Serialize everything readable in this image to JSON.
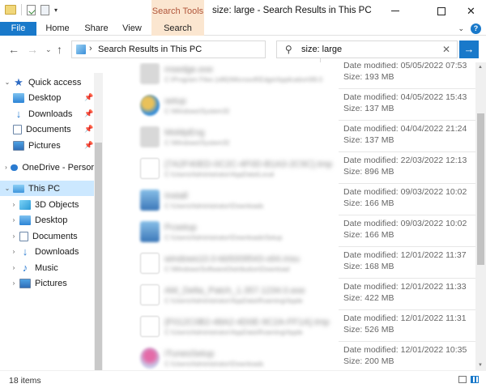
{
  "window": {
    "title": "size: large - Search Results in This PC",
    "context_tab_group": "Search Tools"
  },
  "ribbon": {
    "tabs": [
      "File",
      "Home",
      "Share",
      "View",
      "Search"
    ]
  },
  "address": {
    "path": "Search Results in This PC"
  },
  "search": {
    "query": "size: large"
  },
  "nav": {
    "items": [
      {
        "label": "Quick access"
      },
      {
        "label": "Desktop"
      },
      {
        "label": "Downloads"
      },
      {
        "label": "Documents"
      },
      {
        "label": "Pictures"
      },
      {
        "label": "OneDrive - Persor"
      },
      {
        "label": "This PC"
      },
      {
        "label": "3D Objects"
      },
      {
        "label": "Desktop"
      },
      {
        "label": "Documents"
      },
      {
        "label": "Downloads"
      },
      {
        "label": "Music"
      },
      {
        "label": "Pictures"
      }
    ]
  },
  "results": [
    {
      "name": "msedge.exe",
      "path": "C:\\Program Files (x86)\\Microsoft\\Edge\\Application\\99.0",
      "date_modified": "Date modified: 05/05/2022 07:53",
      "size": "Size: 193 MB",
      "icon": "gray-app-icon"
    },
    {
      "name": "setup",
      "path": "C:\\Windows\\System32",
      "date_modified": "Date modified: 04/05/2022 15:43",
      "size": "Size: 137 MB",
      "icon": "globe-icon"
    },
    {
      "name": "MsMpEng",
      "path": "C:\\Windows\\System32",
      "date_modified": "Date modified: 04/04/2022 21:24",
      "size": "Size: 137 MB",
      "icon": "gray-file-icon"
    },
    {
      "name": "{7A2F40ED-0C2C-4F0D-B1A3-2C9C}.tmp",
      "path": "C:\\Users\\Administrator\\AppData\\Local",
      "date_modified": "Date modified: 22/03/2022 12:13",
      "size": "Size: 896 MB",
      "icon": "file-icon"
    },
    {
      "name": "Install",
      "path": "C:\\Users\\Administrator\\Downloads",
      "date_modified": "Date modified: 09/03/2022 10:02",
      "size": "Size: 166 MB",
      "icon": "pc-icon"
    },
    {
      "name": "Pcsetup",
      "path": "C:\\Users\\Administrator\\Downloads\\Setup",
      "date_modified": "Date modified: 09/03/2022 10:02",
      "size": "Size: 166 MB",
      "icon": "pc-icon"
    },
    {
      "name": "windows10.0-kb5009543-x64.msu",
      "path": "C:\\Windows\\SoftwareDistribution\\Download",
      "date_modified": "Date modified: 12/01/2022 11:37",
      "size": "Size: 168 MB",
      "icon": "file-icon"
    },
    {
      "name": "AM_Delta_Patch_1.357.1234.0.exe",
      "path": "C:\\Users\\Administrator\\AppData\\Roaming\\Apple",
      "date_modified": "Date modified: 12/01/2022 11:33",
      "size": "Size: 422 MB",
      "icon": "file-icon"
    },
    {
      "name": "{F012C0B2-48A2-4D0E-9C2A-FF1A}.tmp",
      "path": "C:\\Users\\Administrator\\AppData\\Roaming\\Apple",
      "date_modified": "Date modified: 12/01/2022 11:31",
      "size": "Size: 526 MB",
      "icon": "file-icon"
    },
    {
      "name": "iTunesSetup",
      "path": "C:\\Users\\Administrator\\Downloads",
      "date_modified": "Date modified: 12/01/2022 10:35",
      "size": "Size: 200 MB",
      "icon": "flower-icon"
    }
  ],
  "status": {
    "item_count": "18 items"
  },
  "colors": {
    "accent": "#1979ca",
    "context_tab": "#fbe6d0",
    "selection": "#cce8ff"
  }
}
